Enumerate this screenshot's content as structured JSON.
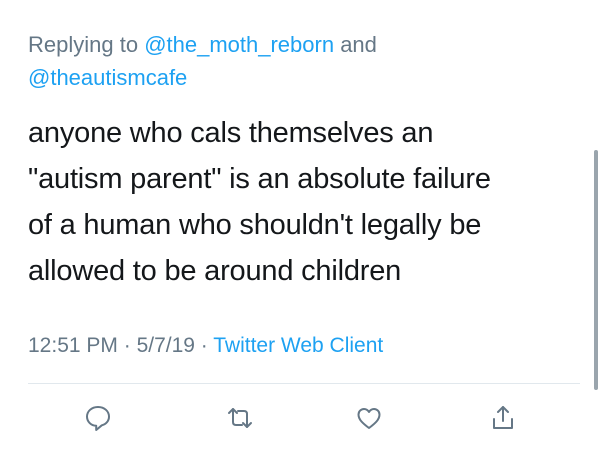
{
  "reply": {
    "prefix": "Replying to ",
    "mention_1": "@the_moth_reborn",
    "conjunction": " and",
    "mention_2": "@theautismcafe"
  },
  "tweet": {
    "lines": [
      "anyone who cals themselves an",
      "\"autism parent\" is an absolute failure",
      "of a human who shouldn't legally be",
      "allowed to be around children"
    ]
  },
  "meta": {
    "time": "12:51 PM",
    "sep_1": " · ",
    "date": "5/7/19",
    "sep_2": " · ",
    "client": "Twitter Web Client"
  },
  "actions": {
    "icons": [
      "reply-icon",
      "retweet-icon",
      "like-icon",
      "share-icon"
    ]
  },
  "colors": {
    "text": "#14171a",
    "secondary": "#657786",
    "link": "#1da1f2",
    "divider": "#e1e8ed"
  }
}
